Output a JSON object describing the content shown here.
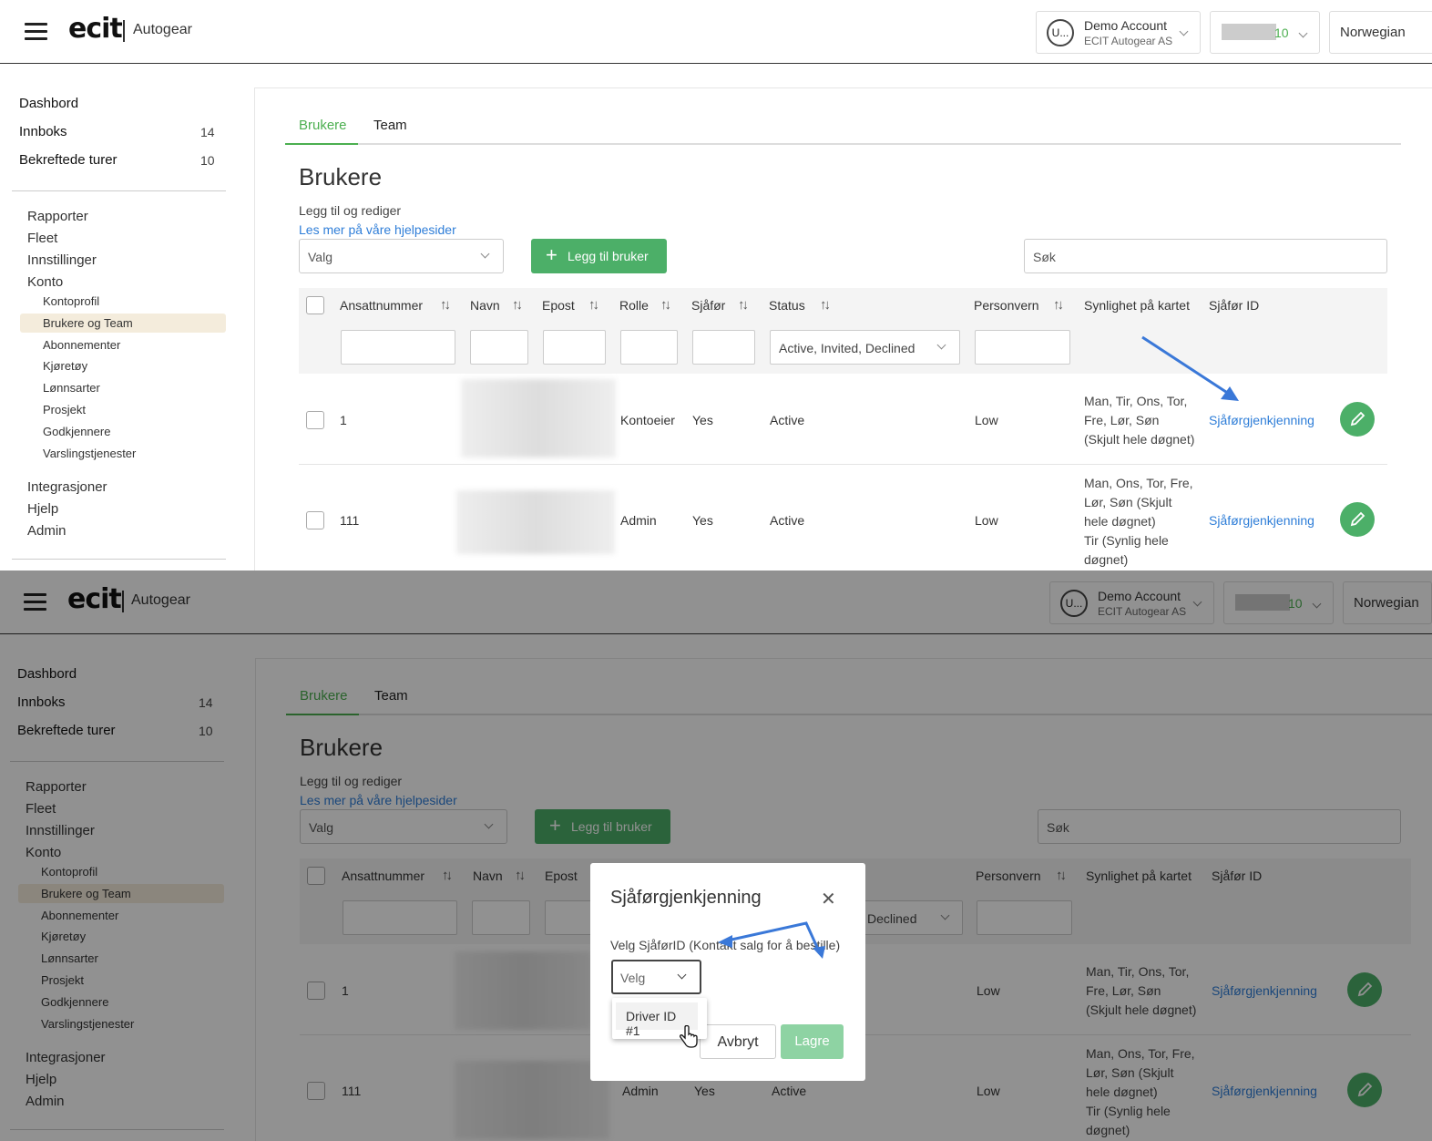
{
  "header": {
    "brand": "ecit",
    "product": "Autogear",
    "account_avatar": "U...",
    "account_name": "Demo Account",
    "account_company": "ECIT Autogear AS",
    "counter": "10",
    "language": "Norwegian"
  },
  "sidebar": {
    "top": [
      {
        "label": "Dashbord",
        "count": ""
      },
      {
        "label": "Innboks",
        "count": "14"
      },
      {
        "label": "Bekreftede turer",
        "count": "10"
      }
    ],
    "sections": [
      "Rapporter",
      "Fleet",
      "Innstillinger",
      "Konto"
    ],
    "konto": [
      "Kontoprofil",
      "Brukere og Team",
      "Abonnementer",
      "Kjøretøy",
      "Lønnsarter",
      "Prosjekt",
      "Godkjennere",
      "Varslingstjenester"
    ],
    "bottom": [
      "Integrasjoner",
      "Hjelp",
      "Admin"
    ]
  },
  "tabs": [
    "Brukere",
    "Team"
  ],
  "page": {
    "title": "Brukere",
    "subtitle": "Legg til og rediger",
    "help_link": "Les mer på våre hjelpesider",
    "select_placeholder": "Valg",
    "add_button": "Legg til bruker",
    "search_placeholder": "Søk"
  },
  "table": {
    "headers": [
      "Ansattnummer",
      "Navn",
      "Epost",
      "Rolle",
      "Sjåfør",
      "Status",
      "Personvern",
      "Synlighet på kartet",
      "Sjåfør ID"
    ],
    "status_filter": "Active, Invited, Declined",
    "status_filter_partial": "Declined",
    "rows": [
      {
        "id": "1",
        "role": "Kontoeier",
        "driver": "Yes",
        "status": "Active",
        "privacy": "Low",
        "visibility": "Man, Tir, Ons, Tor, Fre, Lør, Søn (Skjult hele døgnet)",
        "driver_id": "Sjåførgjenkjenning"
      },
      {
        "id": "111",
        "role": "Admin",
        "driver": "Yes",
        "status": "Active",
        "privacy": "Low",
        "visibility": "Man, Ons, Tor, Fre, Lør, Søn (Skjult hele døgnet)",
        "visibility2": "Tir (Synlig hele døgnet)",
        "driver_id": "Sjåførgjenkjenning"
      }
    ]
  },
  "modal": {
    "title": "Sjåførgjenkjenning",
    "label": "Velg SjåførID (Kontakt salg for å bestille)",
    "select_placeholder": "Velg",
    "option": "Driver ID #1",
    "cancel": "Avbryt",
    "save": "Lagre"
  },
  "colors": {
    "accent": "#4caf50",
    "link": "#2f7ed8",
    "annotation": "#3a78d8"
  }
}
